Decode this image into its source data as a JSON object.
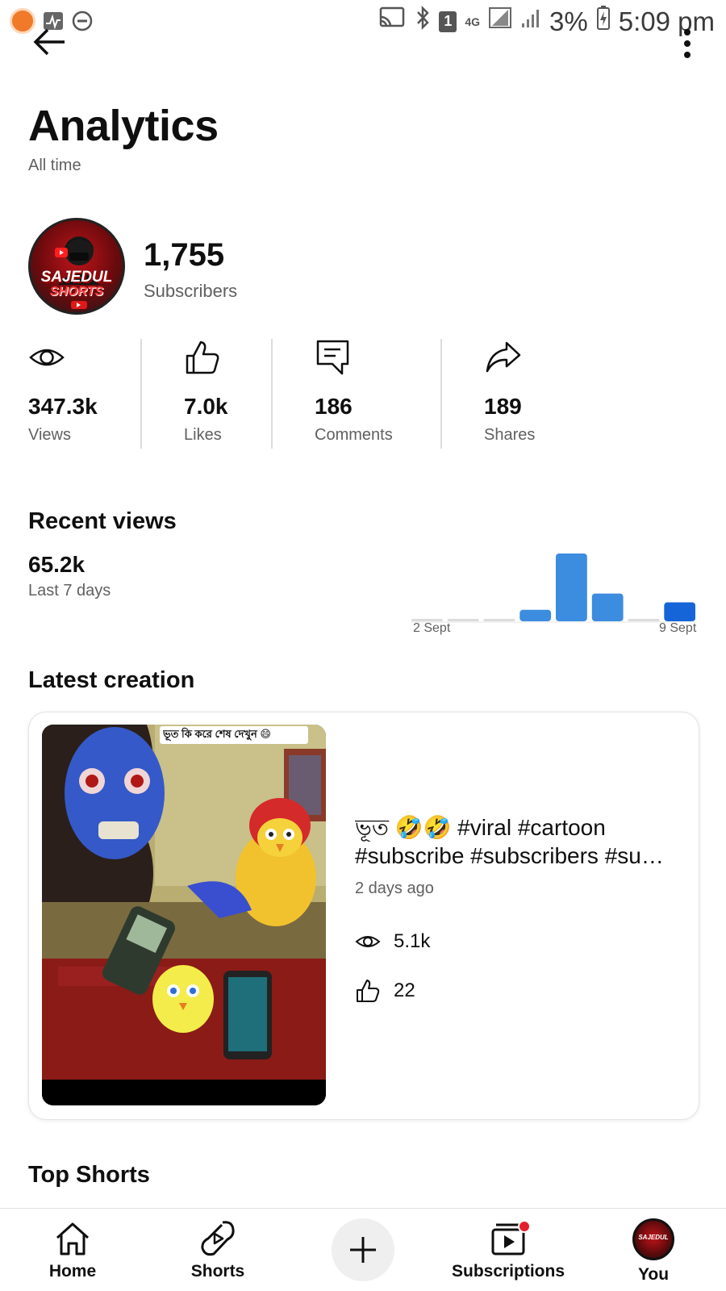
{
  "status_bar": {
    "icons_left": [
      "camera-record-icon",
      "activity-icon",
      "do-not-disturb-icon"
    ],
    "icons_right": [
      "cast-icon",
      "bluetooth-icon",
      "sim-1-icon",
      "4g-icon",
      "signal-icon",
      "signal-2-icon",
      "battery-charging-icon"
    ],
    "sim_label": "1",
    "network": "4G",
    "battery": "3%",
    "time": "5:09 pm"
  },
  "header": {
    "title": "Analytics",
    "period": "All time"
  },
  "channel": {
    "avatar_text_1": "SAJEDUL",
    "avatar_text_2": "SHORTS",
    "subscribers_count": "1,755",
    "subscribers_label": "Subscribers"
  },
  "stats": [
    {
      "icon": "eye-icon",
      "value": "347.3k",
      "label": "Views"
    },
    {
      "icon": "thumb-up-icon",
      "value": "7.0k",
      "label": "Likes"
    },
    {
      "icon": "comment-icon",
      "value": "186",
      "label": "Comments"
    },
    {
      "icon": "share-icon",
      "value": "189",
      "label": "Shares"
    }
  ],
  "recent_views": {
    "heading": "Recent views",
    "value": "65.2k",
    "period_label": "Last 7 days"
  },
  "chart_data": {
    "type": "bar",
    "x_start_label": "2 Sept",
    "x_end_label": "9 Sept",
    "values_relative": [
      0.03,
      0.03,
      0.03,
      0.17,
      1.0,
      0.41,
      0.03,
      0.28
    ],
    "colors": {
      "empty": "#dcdcdc",
      "past": "#3c8ce0",
      "current": "#1565d8"
    }
  },
  "latest": {
    "heading": "Latest creation",
    "thumbnail_caption": "ভূত কি করে শেষ দেখুন 😄",
    "title_line_1": "ভূত 🤣🤣 #viral #cartoon",
    "title_line_2": "#subscribe #subscribers #su…",
    "date": "2 days ago",
    "views": "5.1k",
    "likes": "22"
  },
  "top_shorts": {
    "heading": "Top Shorts"
  },
  "bottom_nav": {
    "home": "Home",
    "shorts": "Shorts",
    "subscriptions": "Subscriptions",
    "you": "You",
    "you_avatar_text": "SAJEDUL"
  }
}
